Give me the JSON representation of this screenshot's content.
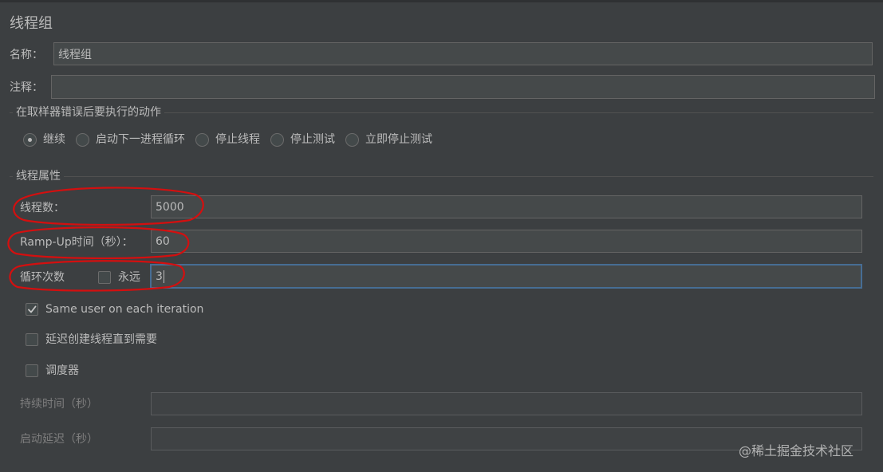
{
  "panel": {
    "title": "线程组"
  },
  "name_field": {
    "label": "名称：",
    "value": "线程组"
  },
  "comment_field": {
    "label": "注释：",
    "value": ""
  },
  "sampler_error_action": {
    "legend": "在取样器错误后要执行的动作",
    "options": [
      {
        "label": "继续",
        "selected": true
      },
      {
        "label": "启动下一进程循环",
        "selected": false
      },
      {
        "label": "停止线程",
        "selected": false
      },
      {
        "label": "停止测试",
        "selected": false
      },
      {
        "label": "立即停止测试",
        "selected": false
      }
    ]
  },
  "thread_properties": {
    "legend": "线程属性",
    "num_threads": {
      "label": "线程数：",
      "value": "5000"
    },
    "ramp_up": {
      "label": "Ramp-Up时间（秒）：",
      "value": "60"
    },
    "loop_count": {
      "label": "循环次数",
      "forever_label": "永远",
      "forever_checked": false,
      "value": "3"
    },
    "same_user": {
      "label": "Same user on each iteration",
      "checked": true
    },
    "delay_create": {
      "label": "延迟创建线程直到需要",
      "checked": false
    },
    "scheduler": {
      "label": "调度器",
      "checked": false
    },
    "duration": {
      "label": "持续时间（秒）",
      "value": ""
    },
    "startup_delay": {
      "label": "启动延迟（秒）",
      "value": ""
    }
  },
  "watermark": "@稀土掘金技术社区",
  "colors": {
    "background": "#3c3f41",
    "field_bg": "#45494a",
    "focus_border": "#466d94",
    "annotation_red": "#d40f0f"
  }
}
